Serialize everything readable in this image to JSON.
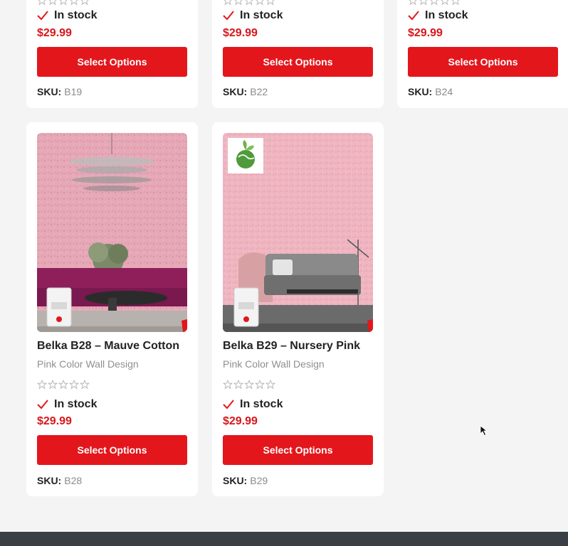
{
  "colors": {
    "accent": "#e3161c",
    "price": "#d8161b",
    "page_bg": "#f4f4f4",
    "card_bg": "#ffffff",
    "footer": "#3a3f46",
    "star_outline": "#b5b5b5"
  },
  "products": [
    {
      "stock": "In stock",
      "price": "$29.99",
      "button": "Select Options",
      "sku_label": "SKU:",
      "sku": "B19"
    },
    {
      "stock": "In stock",
      "price": "$29.99",
      "button": "Select Options",
      "sku_label": "SKU:",
      "sku": "B22"
    },
    {
      "stock": "In stock",
      "price": "$29.99",
      "button": "Select Options",
      "sku_label": "SKU:",
      "sku": "B24"
    },
    {
      "title": "Belka B28 – Mauve Cotton",
      "subtitle": "Pink Color Wall Design",
      "rating": 0,
      "stock": "In stock",
      "price": "$29.99",
      "button": "Select Options",
      "sku_label": "SKU:",
      "sku": "B28",
      "badge": null
    },
    {
      "title": "Belka B29 – Nursery Pink",
      "subtitle": "Pink Color Wall Design",
      "rating": 0,
      "stock": "In stock",
      "price": "$29.99",
      "button": "Select Options",
      "sku_label": "SKU:",
      "sku": "B29",
      "badge": "eco-earth-icon"
    }
  ]
}
